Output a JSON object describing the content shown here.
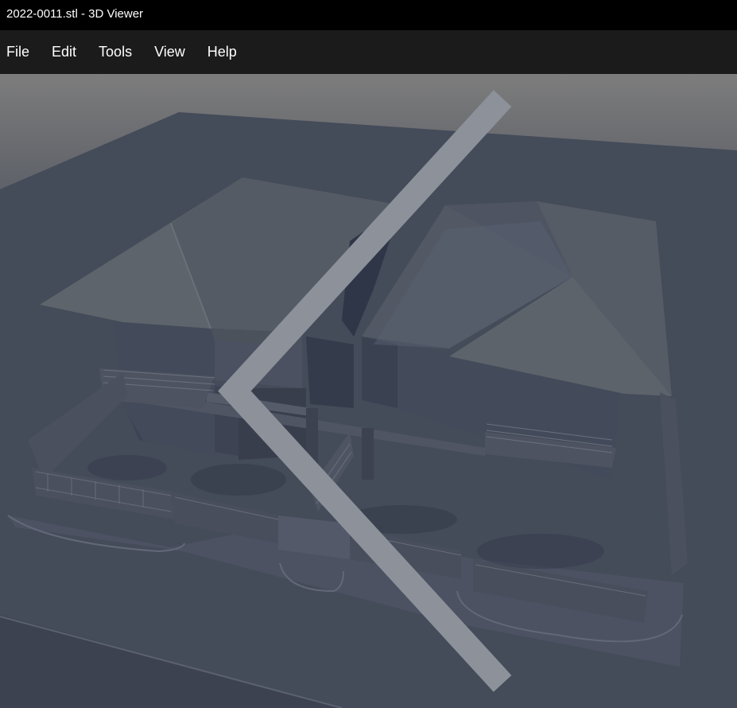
{
  "window": {
    "title": "2022-0011.stl - 3D Viewer"
  },
  "menu": {
    "items": [
      {
        "label": "File"
      },
      {
        "label": "Edit"
      },
      {
        "label": "Tools"
      },
      {
        "label": "View"
      },
      {
        "label": "Help"
      }
    ]
  },
  "viewport": {
    "background_top": "#7d7d7d",
    "background_bottom": "#3e4553",
    "model_color": "#4a5060",
    "icons": [
      "chevron-left-icon"
    ]
  }
}
